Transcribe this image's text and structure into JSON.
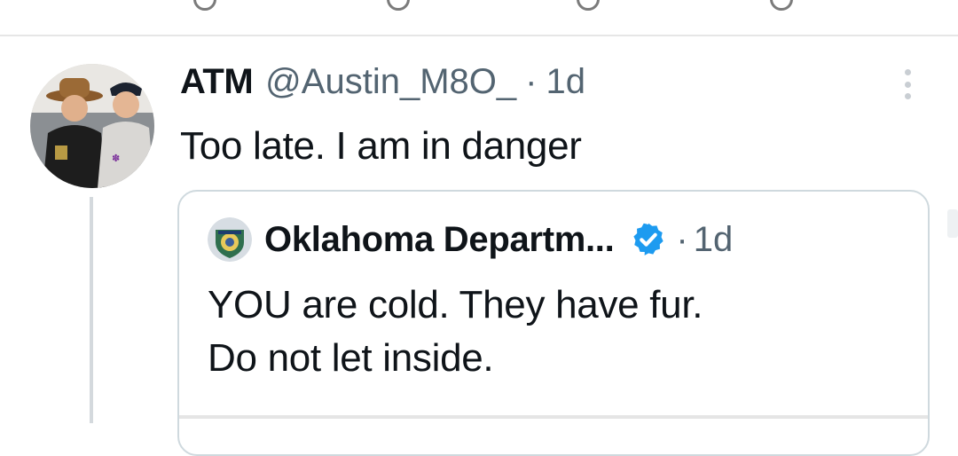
{
  "tweet": {
    "name": "ATM",
    "handle": "@Austin_M8O_",
    "separator": "·",
    "time": "1d",
    "text": "Too late. I am in danger",
    "avatar_icon": "profile-photo",
    "more_icon": "more-vertical-icon"
  },
  "quote": {
    "name": "Oklahoma Departm...",
    "separator": "·",
    "time": "1d",
    "verified_icon": "verified-badge-icon",
    "avatar_icon": "agency-seal",
    "lines": [
      "YOU are cold. They have fur.",
      "Do not let inside."
    ]
  },
  "colors": {
    "text": "#0f1419",
    "secondary": "#536471",
    "verified": "#1d9bf0",
    "border": "#cfd9de",
    "thread_line": "#d4d9dd"
  }
}
